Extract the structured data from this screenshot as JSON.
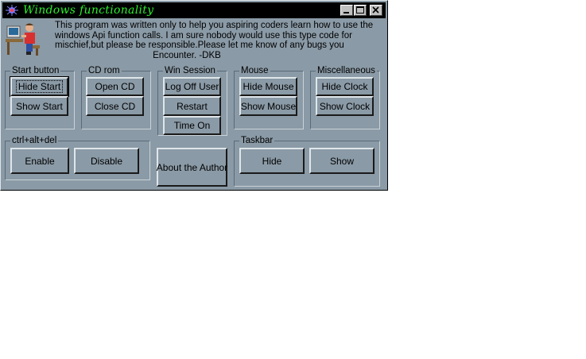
{
  "window": {
    "title": "Windows functionality",
    "intro_lines": [
      "This program was written only to help you aspiring coders learn how to use the",
      "windows Api function calls. I am sure nobody would use this type code for",
      "mischief,but please be responsible.Please let me know of any bugs you",
      "Encounter. -DKB"
    ],
    "controls": {
      "minimize": "minimize",
      "maximize": "maximize",
      "close": "close"
    }
  },
  "groups": {
    "start": {
      "legend": "Start button",
      "hide": "Hide Start",
      "show": "Show Start"
    },
    "cdrom": {
      "legend": "CD rom",
      "open": "Open CD",
      "close": "Close CD"
    },
    "session": {
      "legend": "Win Session",
      "logoff": "Log Off User",
      "restart": "Restart",
      "timeon": "Time On"
    },
    "mouse": {
      "legend": "Mouse",
      "hide": "Hide Mouse",
      "show": "Show Mouse"
    },
    "misc": {
      "legend": "Miscellaneous",
      "hide": "Hide Clock",
      "show": "Show Clock"
    },
    "cad": {
      "legend": "ctrl+alt+del",
      "enable": "Enable",
      "disable": "Disable"
    },
    "taskbar": {
      "legend": "Taskbar",
      "hide": "Hide",
      "show": "Show"
    }
  },
  "about_button": "About the Author",
  "colors": {
    "face": "#8a9aa6",
    "title_bar": "#000000",
    "title_text": "#2bf02b"
  },
  "icons": [
    "app-icon",
    "computer-user-icon",
    "minimize-icon",
    "maximize-icon",
    "close-icon"
  ]
}
